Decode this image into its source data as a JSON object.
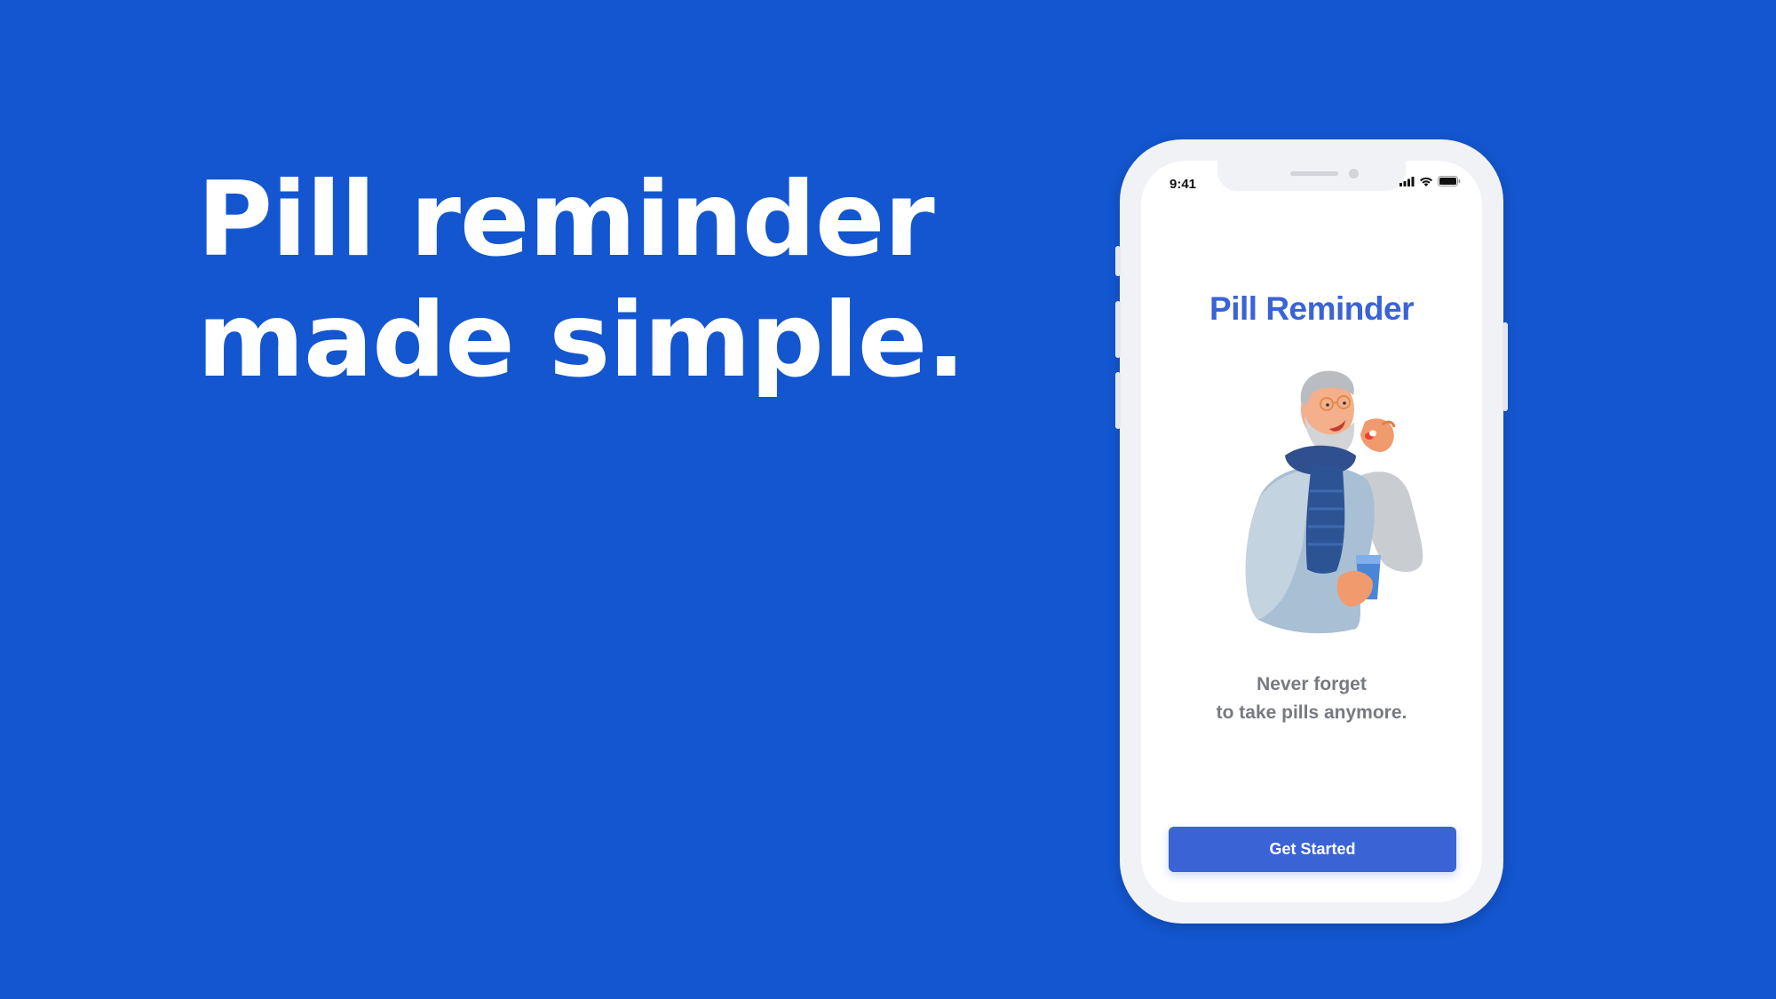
{
  "headline": {
    "line1": "Pill reminder",
    "line2": "made simple."
  },
  "phone": {
    "status_bar": {
      "time": "9:41",
      "icons": [
        "signal-icon",
        "wifi-icon",
        "battery-icon"
      ]
    },
    "app_title": "Pill Reminder",
    "illustration": "elderly-man-taking-pill-illustration",
    "tagline": {
      "line1": "Never forget",
      "line2": "to take pills anymore."
    },
    "cta_label": "Get Started"
  },
  "colors": {
    "background": "#1356cf",
    "accent": "#3a63d6",
    "tagline_gray": "#777a80"
  }
}
